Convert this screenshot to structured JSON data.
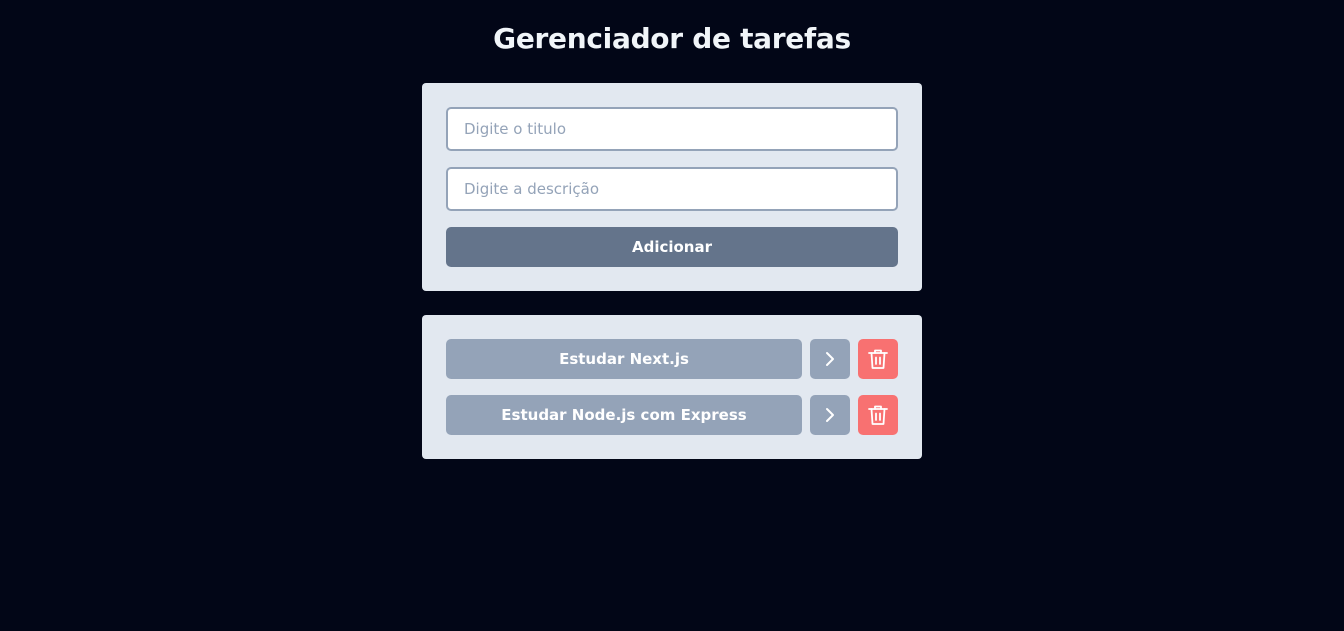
{
  "header": {
    "title": "Gerenciador de tarefas"
  },
  "form": {
    "title_placeholder": "Digite o titulo",
    "title_value": "",
    "description_placeholder": "Digite a descrição",
    "description_value": "",
    "add_label": "Adicionar"
  },
  "tasks": [
    {
      "title": "Estudar Next.js",
      "details_icon": "chevron-right-icon",
      "delete_icon": "trash-icon"
    },
    {
      "title": "Estudar Node.js com Express",
      "details_icon": "chevron-right-icon",
      "delete_icon": "trash-icon"
    }
  ],
  "colors": {
    "background": "#020617",
    "card": "#e2e8f0",
    "primary_button": "#64748b",
    "task_button": "#94a3b8",
    "delete_button": "#f87171",
    "text_light": "#ffffff"
  }
}
